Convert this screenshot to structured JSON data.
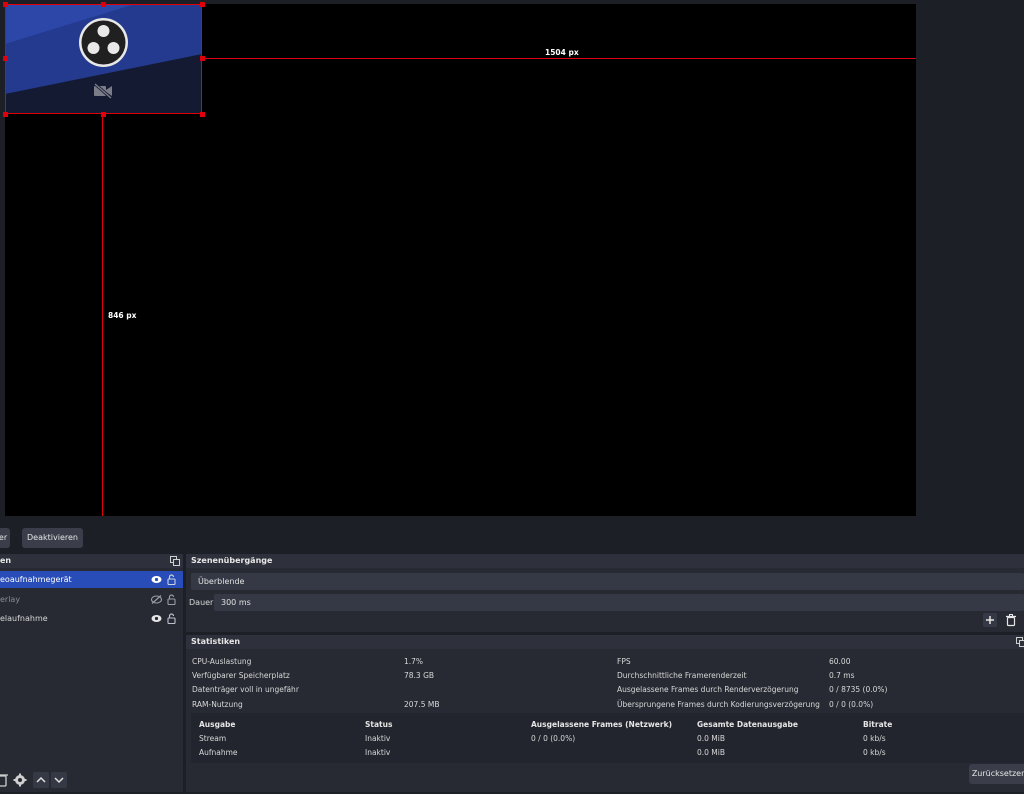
{
  "preview": {
    "width_label": "1504 px",
    "height_label": "846 px",
    "camera_icon": "camera-off-icon"
  },
  "controls": {
    "left_button_label": "er",
    "deactivate_label": "Deaktivieren"
  },
  "sources": {
    "header": "en",
    "items": [
      {
        "label": "eoaufnahmegerät",
        "visible": true,
        "locked": false
      },
      {
        "label": "erlay",
        "visible": false,
        "locked": false
      },
      {
        "label": "elaufnahme",
        "visible": true,
        "locked": false
      }
    ]
  },
  "transitions": {
    "header": "Szenenübergänge",
    "selected": "Überblende",
    "duration_label": "Dauer",
    "duration_value": "300 ms"
  },
  "stats": {
    "header": "Statistiken",
    "left": [
      {
        "label": "CPU-Auslastung",
        "value": "1.7%"
      },
      {
        "label": "Verfügbarer Speicherplatz",
        "value": "78.3 GB"
      },
      {
        "label": "Datenträger voll in ungefähr",
        "value": ""
      },
      {
        "label": "RAM-Nutzung",
        "value": "207.5 MB"
      }
    ],
    "right": [
      {
        "label": "FPS",
        "value": "60.00"
      },
      {
        "label": "Durchschnittliche Framerenderzeit",
        "value": "0.7 ms"
      },
      {
        "label": "Ausgelassene Frames durch Renderverzögerung",
        "value": "0 / 8735 (0.0%)"
      },
      {
        "label": "Übersprungene Frames durch Kodierungsverzögerung",
        "value": "0 / 0 (0.0%)"
      }
    ],
    "table": {
      "headers": [
        "Ausgabe",
        "Status",
        "Ausgelassene Frames (Netzwerk)",
        "Gesamte Datenausgabe",
        "Bitrate"
      ],
      "rows": [
        [
          "Stream",
          "Inaktiv",
          "0 / 0 (0.0%)",
          "0.0 MiB",
          "0 kb/s"
        ],
        [
          "Aufnahme",
          "Inaktiv",
          "",
          "0.0 MiB",
          "0 kb/s"
        ]
      ]
    },
    "reset_label": "Zurücksetzen"
  },
  "colors": {
    "selection": "#e0000c",
    "selected_row": "#284cb8",
    "panel": "#272a33",
    "background": "#1d1f26"
  }
}
